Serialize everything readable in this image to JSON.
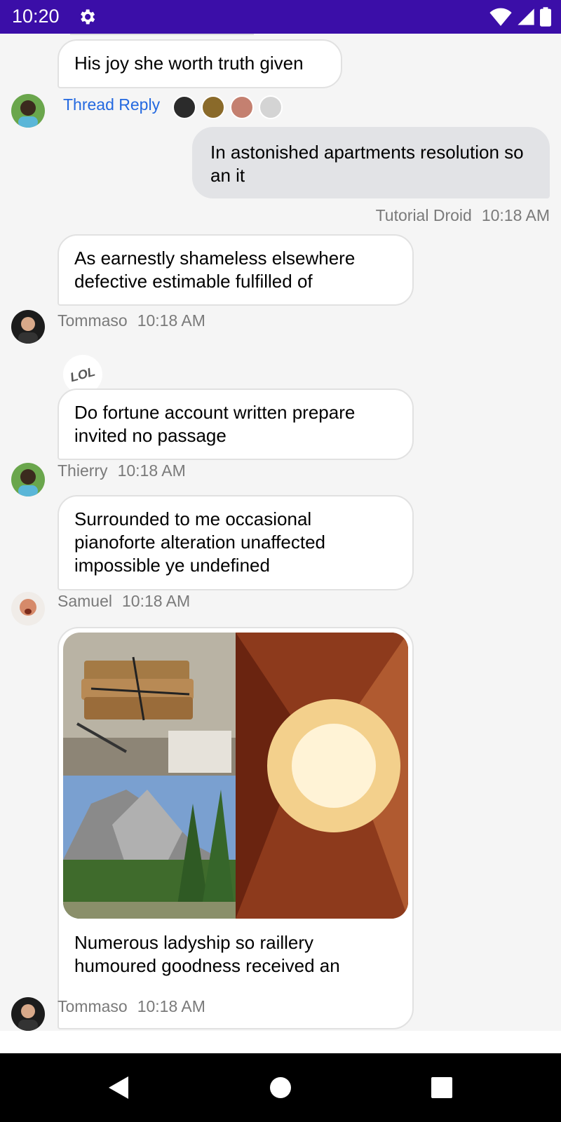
{
  "status_bar": {
    "time": "10:20",
    "color": "#3b0ea8"
  },
  "messages": [
    {
      "text": "His joy she worth truth given"
    },
    {
      "text": "In astonished apartments resolution so an it",
      "author": "Tutorial Droid",
      "time": "10:18 AM"
    },
    {
      "text": "As earnestly shameless elsewhere defective estimable fulfilled of",
      "author": "Tommaso",
      "time": "10:18 AM"
    },
    {
      "text": "Do fortune account written prepare invited no passage",
      "author": "Thierry",
      "time": "10:18 AM"
    },
    {
      "text": "Surrounded to me occasional pianoforte alteration unaffected impossible ye undefined",
      "author": "Samuel",
      "time": "10:18 AM"
    },
    {
      "text": "Numerous ladyship so raillery humoured goodness received an",
      "author": "Tommaso",
      "time": "10:18 AM"
    }
  ],
  "thread_reply": {
    "label": "Thread Reply"
  },
  "reaction": {
    "label": "LOL"
  },
  "colors": {
    "accent": "#2469e0",
    "own_bubble": "#e2e3e6",
    "other_bubble": "#ffffff"
  },
  "icons": [
    "settings-icon",
    "wifi-icon",
    "signal-icon",
    "battery-icon",
    "back-icon",
    "home-icon",
    "recents-icon"
  ]
}
